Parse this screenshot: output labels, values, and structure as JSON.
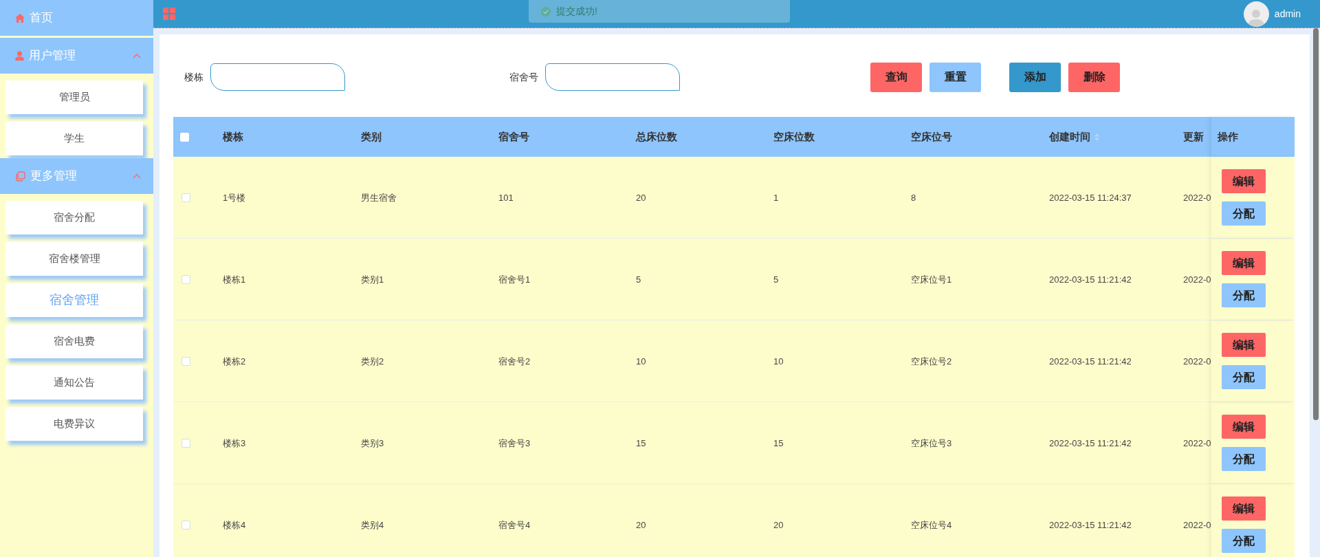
{
  "topbar": {
    "user": "admin"
  },
  "toast": {
    "message": "提交成功!"
  },
  "sidebar": {
    "items": [
      {
        "kind": "link",
        "label": "首页"
      },
      {
        "kind": "group",
        "label": "用户管理",
        "expanded": true,
        "children": [
          {
            "label": "管理员",
            "selected": false
          },
          {
            "label": "学生",
            "selected": false
          }
        ]
      },
      {
        "kind": "group",
        "label": "更多管理",
        "expanded": true,
        "children": [
          {
            "label": "宿舍分配",
            "selected": false
          },
          {
            "label": "宿舍楼管理",
            "selected": false
          },
          {
            "label": "宿舍管理",
            "selected": true
          },
          {
            "label": "宿舍电费",
            "selected": false
          },
          {
            "label": "通知公告",
            "selected": false
          },
          {
            "label": "电费异议",
            "selected": false
          }
        ]
      }
    ]
  },
  "filters": [
    {
      "label": "楼栋"
    },
    {
      "label": "宿舍号"
    }
  ],
  "buttons": [
    {
      "label": "查询",
      "kind": "danger"
    },
    {
      "label": "重置",
      "kind": "light"
    },
    {
      "label": "添加",
      "kind": "primary"
    },
    {
      "label": "删除",
      "kind": "danger"
    }
  ],
  "table": {
    "select_all": {
      "checked": false
    },
    "columns": [
      {
        "label": "楼栋"
      },
      {
        "label": "类别"
      },
      {
        "label": "宿舍号"
      },
      {
        "label": "总床位数"
      },
      {
        "label": "空床位数"
      },
      {
        "label": "空床位号"
      },
      {
        "label": "创建时间",
        "sortable": true
      },
      {
        "label": "更新"
      }
    ],
    "action_column": "操作",
    "rows": [
      {
        "checked": false,
        "cells": [
          "1号楼",
          "男生宿舍",
          "101",
          "20",
          "1",
          "8",
          "2022-03-15 11:24:37",
          "2022-0"
        ],
        "actions": [
          "编辑",
          "分配"
        ]
      },
      {
        "checked": false,
        "cells": [
          "楼栋1",
          "类别1",
          "宿舍号1",
          "5",
          "5",
          "空床位号1",
          "2022-03-15 11:21:42",
          "2022-0"
        ],
        "actions": [
          "编辑",
          "分配"
        ]
      },
      {
        "checked": false,
        "cells": [
          "楼栋2",
          "类别2",
          "宿舍号2",
          "10",
          "10",
          "空床位号2",
          "2022-03-15 11:21:42",
          "2022-0"
        ],
        "actions": [
          "编辑",
          "分配"
        ]
      },
      {
        "checked": false,
        "cells": [
          "楼栋3",
          "类别3",
          "宿舍号3",
          "15",
          "15",
          "空床位号3",
          "2022-03-15 11:21:42",
          "2022-0"
        ],
        "actions": [
          "编辑",
          "分配"
        ]
      },
      {
        "checked": false,
        "cells": [
          "楼栋4",
          "类别4",
          "宿舍号4",
          "20",
          "20",
          "空床位号4",
          "2022-03-15 11:21:42",
          "2022-0"
        ],
        "actions": [
          "编辑",
          "分配"
        ]
      }
    ]
  }
}
